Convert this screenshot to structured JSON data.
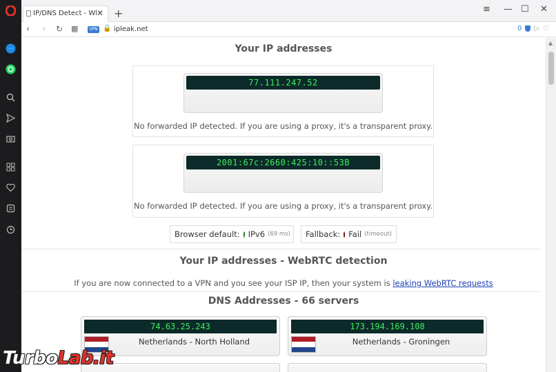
{
  "browser": {
    "tab_title": "IP/DNS Detect - What is y",
    "url": "ipleak.net",
    "vpn_badge": "VPN",
    "shield_count": "0"
  },
  "page": {
    "ip_heading": "Your IP addresses",
    "ipv4": "77.111.247.52",
    "ipv6": "2001:67c:2660:425:10::53B",
    "no_forward_note": "No forwarded IP detected. If you are using a proxy, it's a transparent proxy.",
    "browser_default_label": "Browser default:",
    "browser_default_value": "IPv6",
    "browser_default_time": "(69 ms)",
    "fallback_label": "Fallback:",
    "fallback_value": "Fail",
    "fallback_time": "(timeout)",
    "webrtc_heading": "Your IP addresses - WebRTC detection",
    "webrtc_note": "If you are now connected to a VPN and you see your ISP IP, then your system is",
    "webrtc_link": "leaking WebRTC requests",
    "dns_heading": "DNS Addresses - 66 servers",
    "dns_servers": [
      {
        "ip": "74.63.25.243",
        "location": "Netherlands - North Holland"
      },
      {
        "ip": "173.194.169.108",
        "location": "Netherlands - Groningen"
      }
    ],
    "colors": {
      "lcd_bg": "#0d2a2a",
      "lcd_text": "#3cf05a",
      "ok_dot": "#2fbf2f",
      "fail_dot": "#d11a1a"
    }
  },
  "watermark": {
    "part1": "Turbo",
    "part2": "Lab.it"
  }
}
